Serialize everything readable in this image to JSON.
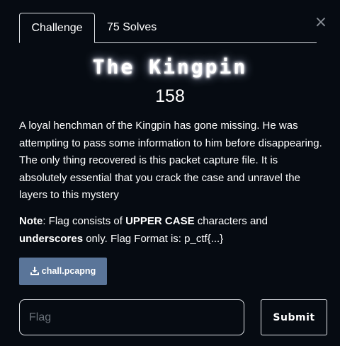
{
  "tabs": {
    "challenge_label": "Challenge",
    "solves_label": "75 Solves"
  },
  "close_glyph": "×",
  "challenge": {
    "name": "The Kingpin",
    "value": "158",
    "description": "A loyal henchman of the Kingpin has gone missing. He was attempting to pass some information to him before disappearing. The only thing recovered is this packet capture file. It is absolutely essential that you crack the case and unravel the layers to this mystery",
    "note": {
      "label": "Note",
      "t1": ": Flag consists of ",
      "b1": "UPPER CASE",
      "t2": " characters and ",
      "b2": "underscores",
      "t3": " only. Flag Format is: p_ctf{...}"
    },
    "file": {
      "icon": "download-icon",
      "name": "chall.pcapng"
    }
  },
  "form": {
    "flag_placeholder": "Flag",
    "flag_value": "",
    "submit_label": "Submit"
  },
  "colors": {
    "background": "#060b12",
    "file_button": "#5a7599",
    "border": "#dee2e6"
  }
}
